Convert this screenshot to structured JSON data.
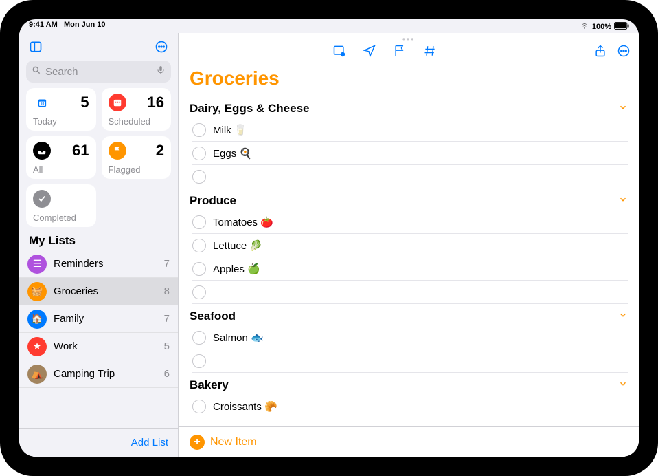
{
  "status": {
    "time": "9:41 AM",
    "date": "Mon Jun 10",
    "battery": "100%"
  },
  "sidebar": {
    "search_placeholder": "Search",
    "cards": {
      "today": {
        "label": "Today",
        "count": "5",
        "color": "#007aff"
      },
      "scheduled": {
        "label": "Scheduled",
        "count": "16",
        "color": "#ff3b30"
      },
      "all": {
        "label": "All",
        "count": "61",
        "color": "#000000"
      },
      "flagged": {
        "label": "Flagged",
        "count": "2",
        "color": "#ff9500"
      },
      "completed": {
        "label": "Completed",
        "color": "#8e8e93"
      }
    },
    "mylists_title": "My Lists",
    "lists": [
      {
        "name": "Reminders",
        "count": "7",
        "color": "#af52de",
        "glyph": "☰"
      },
      {
        "name": "Groceries",
        "count": "8",
        "color": "#ff9500",
        "glyph": "🧺",
        "selected": true
      },
      {
        "name": "Family",
        "count": "7",
        "color": "#007aff",
        "glyph": "🏠"
      },
      {
        "name": "Work",
        "count": "5",
        "color": "#ff3b30",
        "glyph": "★"
      },
      {
        "name": "Camping Trip",
        "count": "6",
        "color": "#a2845e",
        "glyph": "⛺"
      }
    ],
    "add_list": "Add List"
  },
  "main": {
    "title": "Groceries",
    "accent": "#ff9500",
    "new_item": "New Item",
    "sections": [
      {
        "title": "Dairy, Eggs & Cheese",
        "items": [
          {
            "text": "Milk 🥛"
          },
          {
            "text": "Eggs 🍳"
          },
          {
            "text": ""
          }
        ]
      },
      {
        "title": "Produce",
        "items": [
          {
            "text": "Tomatoes 🍅"
          },
          {
            "text": "Lettuce 🥬"
          },
          {
            "text": "Apples 🍏"
          },
          {
            "text": ""
          }
        ]
      },
      {
        "title": "Seafood",
        "items": [
          {
            "text": "Salmon 🐟"
          },
          {
            "text": ""
          }
        ]
      },
      {
        "title": "Bakery",
        "items": [
          {
            "text": "Croissants 🥐"
          }
        ]
      }
    ]
  }
}
